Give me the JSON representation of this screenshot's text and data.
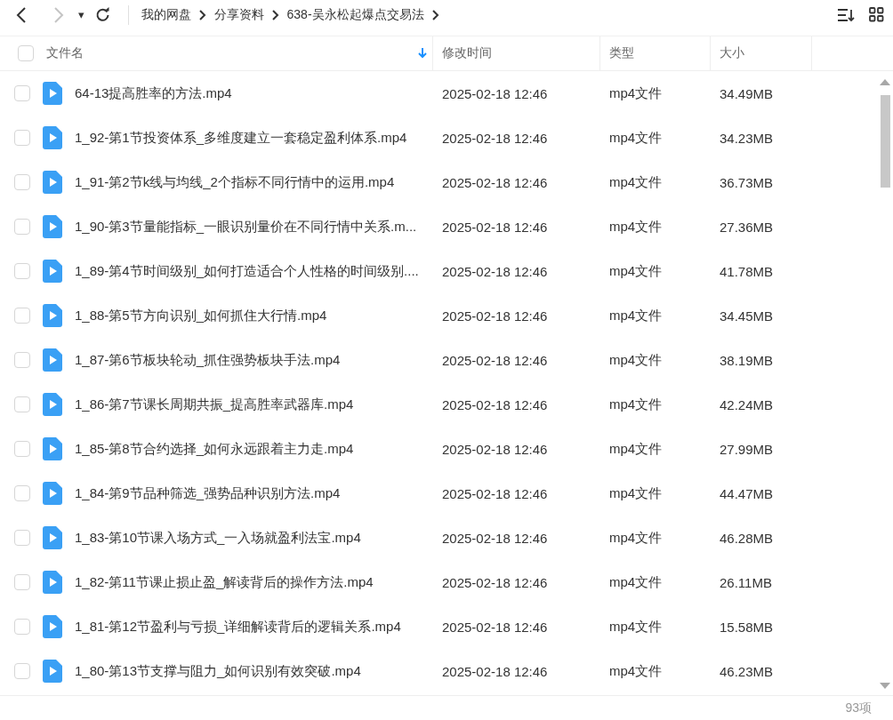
{
  "nav": {
    "back_disabled": false,
    "forward_disabled": true,
    "dropdown": "▾"
  },
  "breadcrumb": [
    "我的网盘",
    "分享资料",
    "638-吴永松起爆点交易法"
  ],
  "table": {
    "select_all_checked": false,
    "columns": [
      {
        "label": "文件名",
        "sorted": true
      },
      {
        "label": "修改时间",
        "sorted": false
      },
      {
        "label": "类型",
        "sorted": false
      },
      {
        "label": "大小",
        "sorted": false
      }
    ],
    "rows": [
      {
        "name": "64-13提高胜率的方法.mp4",
        "modified": "2025-02-18 12:46",
        "type": "mp4文件",
        "size": "34.49MB",
        "checked": false
      },
      {
        "name": "1_92-第1节投资体系_多维度建立一套稳定盈利体系.mp4",
        "modified": "2025-02-18 12:46",
        "type": "mp4文件",
        "size": "34.23MB",
        "checked": false
      },
      {
        "name": "1_91-第2节k线与均线_2个指标不同行情中的运用.mp4",
        "modified": "2025-02-18 12:46",
        "type": "mp4文件",
        "size": "36.73MB",
        "checked": false
      },
      {
        "name": "1_90-第3节量能指标_一眼识别量价在不同行情中关系.m...",
        "modified": "2025-02-18 12:46",
        "type": "mp4文件",
        "size": "27.36MB",
        "checked": false
      },
      {
        "name": "1_89-第4节时间级别_如何打造适合个人性格的时间级别....",
        "modified": "2025-02-18 12:46",
        "type": "mp4文件",
        "size": "41.78MB",
        "checked": false
      },
      {
        "name": "1_88-第5节方向识别_如何抓住大行情.mp4",
        "modified": "2025-02-18 12:46",
        "type": "mp4文件",
        "size": "34.45MB",
        "checked": false
      },
      {
        "name": "1_87-第6节板块轮动_抓住强势板块手法.mp4",
        "modified": "2025-02-18 12:46",
        "type": "mp4文件",
        "size": "38.19MB",
        "checked": false
      },
      {
        "name": "1_86-第7节课长周期共振_提高胜率武器库.mp4",
        "modified": "2025-02-18 12:46",
        "type": "mp4文件",
        "size": "42.24MB",
        "checked": false
      },
      {
        "name": "1_85-第8节合约选择_如何永远跟着主力走.mp4",
        "modified": "2025-02-18 12:46",
        "type": "mp4文件",
        "size": "27.99MB",
        "checked": false
      },
      {
        "name": "1_84-第9节品种筛选_强势品种识别方法.mp4",
        "modified": "2025-02-18 12:46",
        "type": "mp4文件",
        "size": "44.47MB",
        "checked": false
      },
      {
        "name": "1_83-第10节课入场方式_一入场就盈利法宝.mp4",
        "modified": "2025-02-18 12:46",
        "type": "mp4文件",
        "size": "46.28MB",
        "checked": false
      },
      {
        "name": "1_82-第11节课止损止盈_解读背后的操作方法.mp4",
        "modified": "2025-02-18 12:46",
        "type": "mp4文件",
        "size": "26.11MB",
        "checked": false
      },
      {
        "name": "1_81-第12节盈利与亏损_详细解读背后的逻辑关系.mp4",
        "modified": "2025-02-18 12:46",
        "type": "mp4文件",
        "size": "15.58MB",
        "checked": false
      },
      {
        "name": "1_80-第13节支撑与阻力_如何识别有效突破.mp4",
        "modified": "2025-02-18 12:46",
        "type": "mp4文件",
        "size": "46.23MB",
        "checked": false
      }
    ]
  },
  "footer": {
    "count": "93项"
  }
}
